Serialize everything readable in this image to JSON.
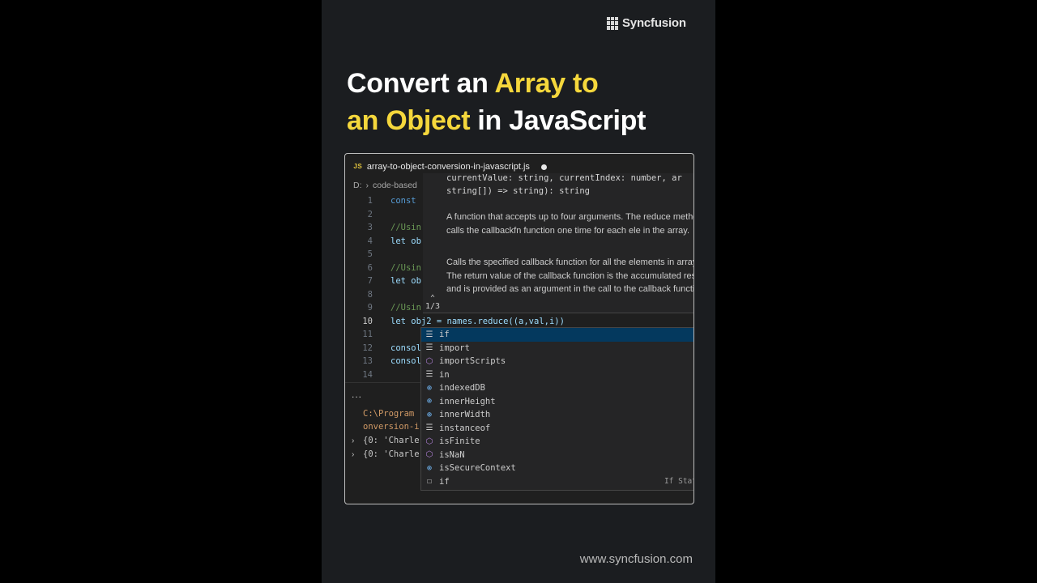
{
  "brand": {
    "logo_text": "Syncfusion",
    "url": "www.syncfusion.com"
  },
  "headline": {
    "line1_a": "Convert an ",
    "line1_b": "Array to",
    "line2_a": "an Object",
    "line2_b": " in JavaScript"
  },
  "colors": {
    "accent": "#f5d73c",
    "background": "#1b1d20",
    "editor_bg": "#1f1f1f",
    "selection": "#04395e"
  },
  "editor": {
    "tab_icon": "JS",
    "file_name": "array-to-object-conversion-in-javascript.js",
    "breadcrumb": [
      "D:",
      "code-based"
    ],
    "lines": [
      {
        "no": "1",
        "text": "const"
      },
      {
        "no": "2",
        "text": ""
      },
      {
        "no": "3",
        "text": "//Usin"
      },
      {
        "no": "4",
        "text": "let ob"
      },
      {
        "no": "5",
        "text": ""
      },
      {
        "no": "6",
        "text": "//Usin"
      },
      {
        "no": "7",
        "text": "let ob"
      },
      {
        "no": "8",
        "text": ""
      },
      {
        "no": "9",
        "text": "//Usin"
      },
      {
        "no": "10",
        "text": "let obj2 = names.reduce((a,val,i))"
      },
      {
        "no": "11",
        "text": ""
      },
      {
        "no": "12",
        "text": "consol"
      },
      {
        "no": "13",
        "text": "consol"
      },
      {
        "no": "14",
        "text": ""
      }
    ],
    "terminal": {
      "more": "...",
      "path1": "C:\\Program",
      "path2": "onversion-i",
      "out1": "{0: 'Charle",
      "out2": "{0: 'Charle"
    },
    "hover": {
      "sig1": "currentValue: string, currentIndex: number, ar",
      "sig2": "string[]) => string): string",
      "doc1": "A function that accepts up to four arguments. The reduce method calls the callbackfn function one time for each ele in the array.",
      "doc2": "Calls the specified callback function for all the elements in array. The return value of the callback function is the accumulated result, and is provided as an argument in the call to the callback function.",
      "pager": "1/3"
    },
    "suggestions": [
      {
        "label": "if",
        "kind": "keyword-icon"
      },
      {
        "label": "import",
        "kind": "keyword-icon"
      },
      {
        "label": "importScripts",
        "kind": "function-icon"
      },
      {
        "label": "in",
        "kind": "keyword-icon"
      },
      {
        "label": "indexedDB",
        "kind": "variable-icon"
      },
      {
        "label": "innerHeight",
        "kind": "variable-icon"
      },
      {
        "label": "innerWidth",
        "kind": "variable-icon"
      },
      {
        "label": "instanceof",
        "kind": "keyword-icon"
      },
      {
        "label": "isFinite",
        "kind": "function-icon"
      },
      {
        "label": "isNaN",
        "kind": "function-icon"
      },
      {
        "label": "isSecureContext",
        "kind": "variable-icon"
      },
      {
        "label": "if",
        "kind": "snippet-icon",
        "detail": "If Stat"
      }
    ]
  }
}
